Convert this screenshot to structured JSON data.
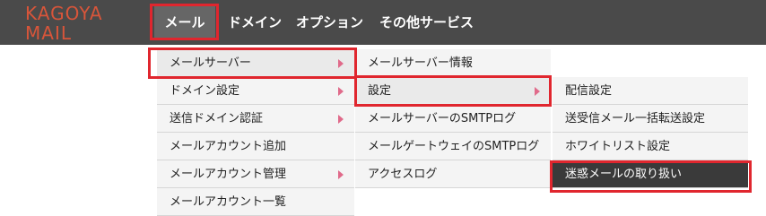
{
  "logo": {
    "line1": "KAGOYA",
    "line2": "MAIL"
  },
  "nav": {
    "mail": "メール",
    "domain": "ドメイン",
    "option": "オプション",
    "other": "その他サービス"
  },
  "menu1": {
    "items": [
      {
        "label": "メールサーバー",
        "submenu": true
      },
      {
        "label": "ドメイン設定",
        "submenu": true
      },
      {
        "label": "送信ドメイン認証",
        "submenu": true
      },
      {
        "label": "メールアカウント追加",
        "submenu": false
      },
      {
        "label": "メールアカウント管理",
        "submenu": true
      },
      {
        "label": "メールアカウント一覧",
        "submenu": false
      }
    ]
  },
  "menu2": {
    "items": [
      {
        "label": "メールサーバー情報",
        "submenu": false
      },
      {
        "label": "設定",
        "submenu": true
      },
      {
        "label": "メールサーバーのSMTPログ",
        "submenu": false
      },
      {
        "label": "メールゲートウェイのSMTPログ",
        "submenu": false
      },
      {
        "label": "アクセスログ",
        "submenu": false
      }
    ]
  },
  "menu3": {
    "items": [
      {
        "label": "配信設定"
      },
      {
        "label": "送受信メール一括転送設定"
      },
      {
        "label": "ホワイトリスト設定"
      },
      {
        "label": "迷惑メールの取り扱い"
      }
    ]
  },
  "colors": {
    "topbar": "#4a4a4a",
    "logo": "#d8553a",
    "highlight": "#e0262e",
    "arrow": "#e06a8a",
    "selected_dark": "#3a3a3a"
  }
}
